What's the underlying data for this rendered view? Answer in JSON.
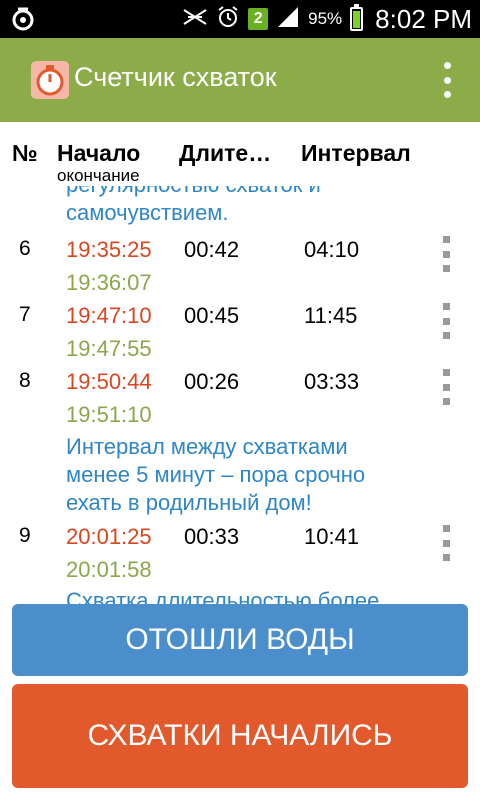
{
  "status_bar": {
    "sim_number": "2",
    "battery_percent": "95%",
    "battery_level": 0.95,
    "time": "8:02 PM"
  },
  "app_bar": {
    "title": "Счетчик схваток",
    "accent_color": "#8cac4a"
  },
  "columns": {
    "number": "№",
    "start": "Начало",
    "duration": "Длите…",
    "interval": "Интервал",
    "end_sub": "окончание"
  },
  "messages": {
    "top_line1": "регулярностью схваток и",
    "top_line2": "самочувствием.",
    "warn_line1": "Интервал между схватками",
    "warn_line2": "менее 5 минут – пора срочно",
    "warn_line3": "ехать в родильный дом!",
    "bottom_line1": "Схватка длительностью более"
  },
  "rows": [
    {
      "num": "6",
      "start": "19:35:25",
      "end": "19:36:07",
      "duration": "00:42",
      "interval": "04:10"
    },
    {
      "num": "7",
      "start": "19:47:10",
      "end": "19:47:55",
      "duration": "00:45",
      "interval": "11:45"
    },
    {
      "num": "8",
      "start": "19:50:44",
      "end": "19:51:10",
      "duration": "00:26",
      "interval": "03:33"
    },
    {
      "num": "9",
      "start": "20:01:25",
      "end": "20:01:58",
      "duration": "00:33",
      "interval": "10:41"
    }
  ],
  "buttons": {
    "water_broke": "ОТОШЛИ ВОДЫ",
    "contractions_started": "СХВАТКИ НАЧАЛИСЬ"
  }
}
